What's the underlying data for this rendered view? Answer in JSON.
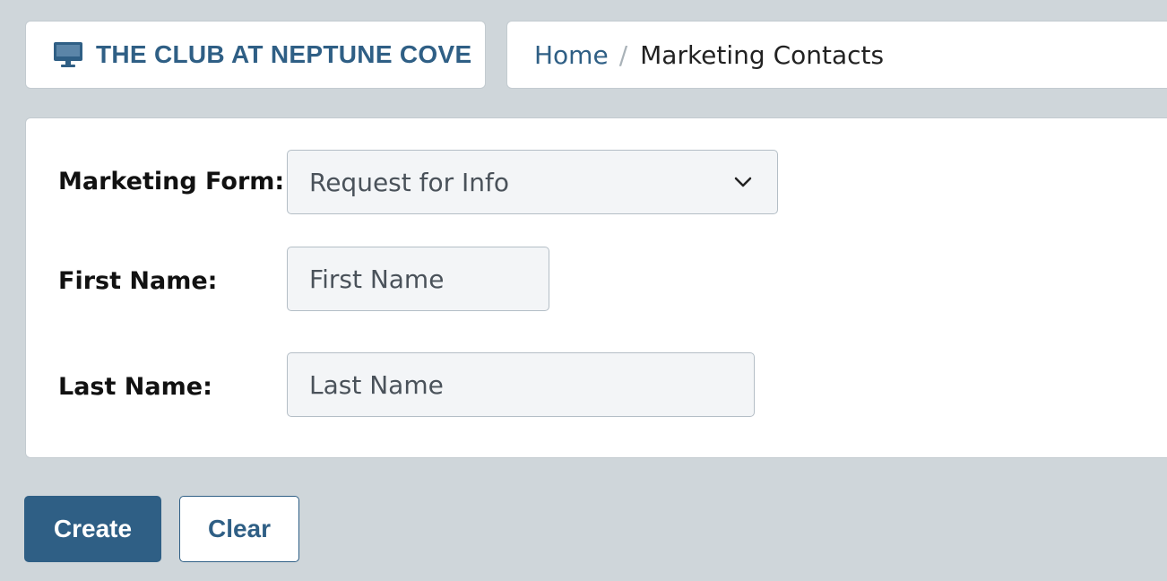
{
  "header": {
    "brand_icon": "monitor-icon",
    "brand_title": "THE CLUB AT NEPTUNE COVE",
    "brand_color": "#2f5f85"
  },
  "breadcrumb": {
    "home": "Home",
    "separator": "/",
    "current": "Marketing Contacts"
  },
  "form": {
    "marketing_form": {
      "label": "Marketing Form:",
      "selected": "Request for Info"
    },
    "first_name": {
      "label": "First Name:",
      "placeholder": "First Name",
      "value": ""
    },
    "last_name": {
      "label": "Last Name:",
      "placeholder": "Last Name",
      "value": ""
    }
  },
  "actions": {
    "create_label": "Create",
    "clear_label": "Clear"
  }
}
